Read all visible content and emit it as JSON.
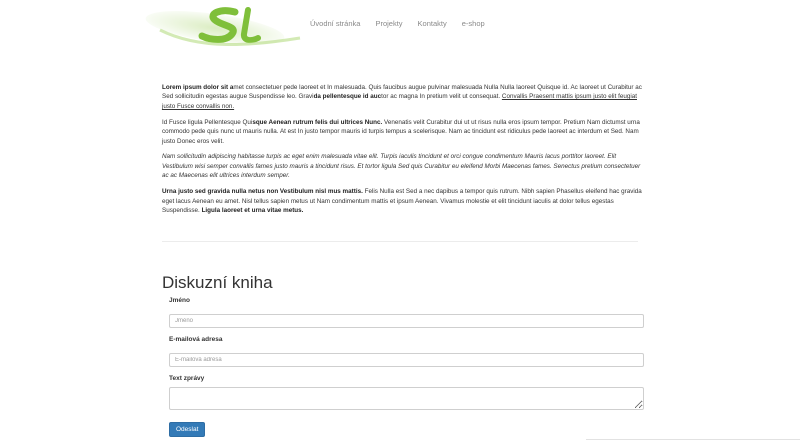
{
  "nav": {
    "items": [
      "Úvodní stránka",
      "Projekty",
      "Kontakty",
      "e-shop"
    ]
  },
  "colors": {
    "logo_green": "#8dc63f",
    "button_blue": "#337ab7"
  },
  "article": {
    "p1": {
      "b1": "Lorem ipsum dolor sit a",
      "t1": "met consectetuer pede laoreet et In malesuada. Quis faucibus augue pulvinar malesuada Nulla Nulla laoreet Quisque id. Ac laoreet ut Curabitur ac Sed sollicitudin egestas augue Suspendisse leo. Gravi",
      "b2": "da pellentesque id auc",
      "t2": "tor ac magna In pretium velit ut consequat. ",
      "link": "Convallis Praesent mattis ipsum justo elit feugiat justo Fusce convallis non."
    },
    "p2": {
      "t1": "Id Fusce ligula Pellentesque Qui",
      "b1": "sque Aenean rutrum felis dui ultrices Nunc.",
      "t2": " Venenatis velit Curabitur dui ut ut risus nulla eros ipsum tempor. Pretium Nam dictumst urna commodo pede quis nunc ut mauris nulla. At est In justo tempor mauris id turpis tempus a scelerisque. Nam ac tincidunt est ridiculus pede laoreet ac interdum et Sed. Nam justo Donec eros velit."
    },
    "p3": "Nam sollicitudin adipiscing habitasse turpis ac eget enim malesuada vitae elit. Turpis iaculis tincidunt et orci congue condimentum Mauris lacus porttitor laoreet. Elit Vestibulum wisi semper convallis fames justo mauris a tincidunt risus. Et tortor ligula Sed quis Curabitur eu eleifend Morbi Maecenas fames. Senectus pretium consectetuer ac ac Maecenas elit ultrices interdum semper.",
    "p4": {
      "b1": "Urna justo sed gravida nulla netus non Vestibulum nisl mus mattis.",
      "t1": " Felis Nulla est Sed a nec dapibus a tempor quis rutrum. Nibh sapien Phasellus eleifend hac gravida eget lacus Aenean eu amet. Nisl tellus sapien metus ut Nam condimentum mattis et ipsum Aenean. Vivamus molestie et elit tincidunt iaculis at dolor tellus egestas Suspendisse. ",
      "b2": "Ligula laoreet et urna vitae metus."
    }
  },
  "guestbook": {
    "title": "Diskuzní kniha",
    "name_label": "Jméno",
    "name_placeholder": "Jméno",
    "email_label": "E-mailová adresa",
    "email_placeholder": "E-mailová adresa",
    "message_label": "Text zprávy",
    "submit_label": "Odeslat"
  }
}
